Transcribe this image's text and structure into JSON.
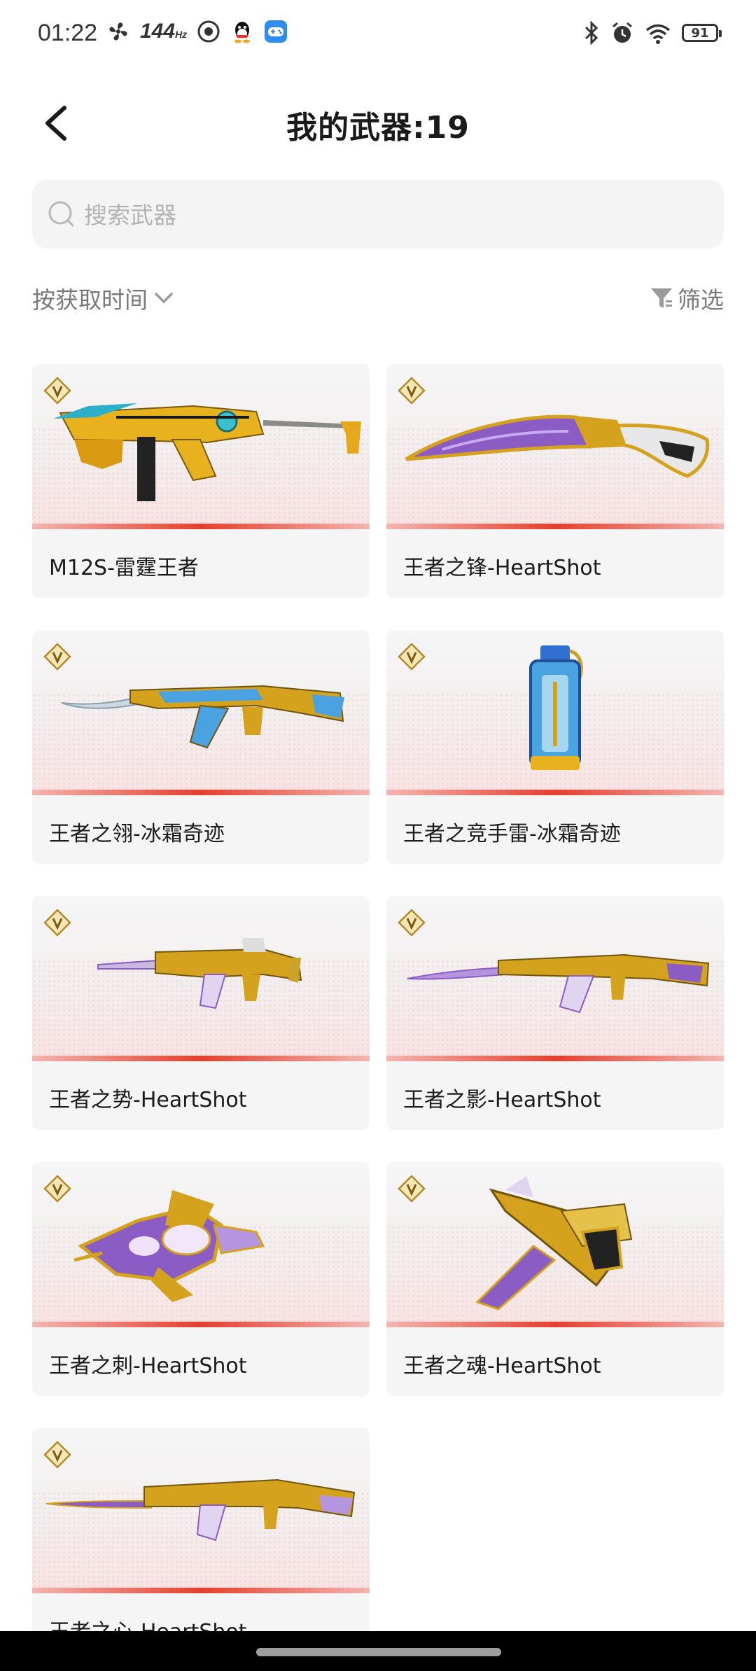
{
  "status_bar": {
    "time": "01:22",
    "refresh_rate": "144",
    "refresh_unit": "Hz",
    "battery": "91"
  },
  "header": {
    "title": "我的武器:19"
  },
  "search": {
    "placeholder": "搜索武器"
  },
  "sort": {
    "label": "按获取时间"
  },
  "filter": {
    "label": "筛选"
  },
  "weapons": [
    {
      "name": "M12S-雷霆王者",
      "icon": "smg-gold"
    },
    {
      "name": "王者之锋-HeartShot",
      "icon": "knife-purple-gold"
    },
    {
      "name": "王者之翎-冰霜奇迹",
      "icon": "rifle-ice-gold"
    },
    {
      "name": "王者之竞手雷-冰霜奇迹",
      "icon": "grenade-blue"
    },
    {
      "name": "王者之势-HeartShot",
      "icon": "rifle-m4-gold"
    },
    {
      "name": "王者之影-HeartShot",
      "icon": "rifle-ak-gold"
    },
    {
      "name": "王者之刺-HeartShot",
      "icon": "gun-ornate-purple"
    },
    {
      "name": "王者之魂-HeartShot",
      "icon": "pistol-gold"
    },
    {
      "name": "王者之心-HeartShot",
      "icon": "rifle-ak-bayonet-gold"
    }
  ],
  "colors": {
    "accent_line": "#e3402f",
    "card_bg": "#f5f5f5",
    "gold": "#d4a21c",
    "purple": "#8b5cc4",
    "ice_blue": "#4aa3e0"
  }
}
